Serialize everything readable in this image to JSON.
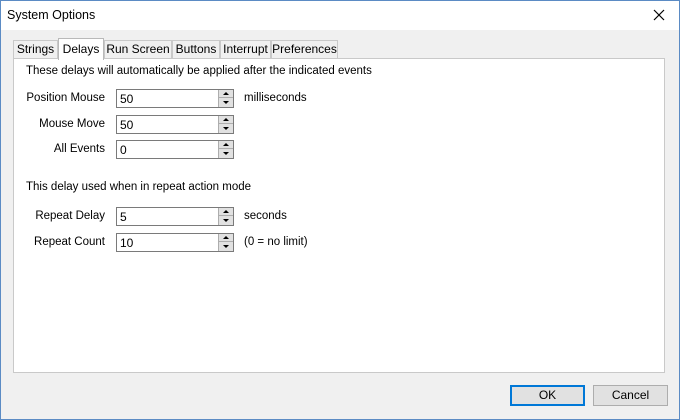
{
  "window": {
    "title": "System Options"
  },
  "tabs": [
    {
      "label": "Strings"
    },
    {
      "label": "Delays"
    },
    {
      "label": "Run Screen"
    },
    {
      "label": "Buttons"
    },
    {
      "label": "Interrupt"
    },
    {
      "label": "Preferences"
    }
  ],
  "active_tab": "Delays",
  "delays": {
    "intro": "These delays will automatically be applied after the indicated events",
    "position_mouse": {
      "label": "Position Mouse",
      "value": "50",
      "unit": "milliseconds"
    },
    "mouse_move": {
      "label": "Mouse Move",
      "value": "50"
    },
    "all_events": {
      "label": "All Events",
      "value": "0"
    },
    "repeat_intro": "This delay used when in repeat action mode",
    "repeat_delay": {
      "label": "Repeat Delay",
      "value": "5",
      "unit": "seconds"
    },
    "repeat_count": {
      "label": "Repeat Count",
      "value": "10",
      "note": "(0 = no limit)"
    }
  },
  "buttons": {
    "ok": "OK",
    "cancel": "Cancel"
  }
}
